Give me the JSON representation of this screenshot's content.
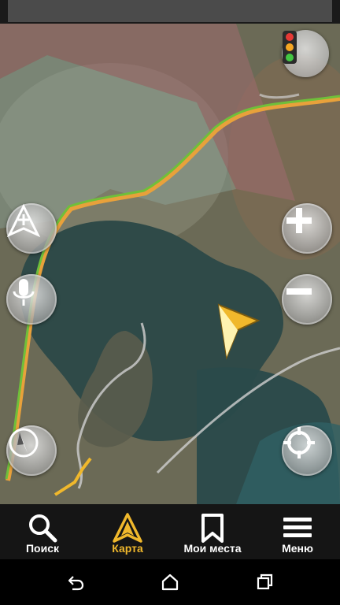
{
  "colors": {
    "accent": "#f0b82c",
    "route_green": "#6fbf3a",
    "route_orange": "#e8a13b",
    "zone_red": "#a26a6a",
    "water": "#2f4a48",
    "navbar_bg": "#151515"
  },
  "map": {
    "controls": [
      {
        "name": "traffic-button",
        "icon": "traffic-light-icon"
      },
      {
        "name": "add-point-button",
        "icon": "add-point-icon"
      },
      {
        "name": "voice-button",
        "icon": "microphone-icon"
      },
      {
        "name": "compass-button",
        "icon": "compass-icon"
      },
      {
        "name": "zoom-in-button",
        "icon": "plus-icon"
      },
      {
        "name": "zoom-out-button",
        "icon": "minus-icon"
      },
      {
        "name": "locate-button",
        "icon": "crosshair-icon"
      }
    ]
  },
  "bottom_nav": {
    "items": [
      {
        "label": "Поиск",
        "icon": "search-icon",
        "active": false
      },
      {
        "label": "Карта",
        "icon": "map-arrow-icon",
        "active": true
      },
      {
        "label": "Мои места",
        "icon": "bookmark-icon",
        "active": false
      },
      {
        "label": "Меню",
        "icon": "hamburger-icon",
        "active": false
      }
    ]
  },
  "system_nav": {
    "buttons": [
      {
        "icon": "back-icon"
      },
      {
        "icon": "home-icon"
      },
      {
        "icon": "recents-icon"
      }
    ]
  }
}
